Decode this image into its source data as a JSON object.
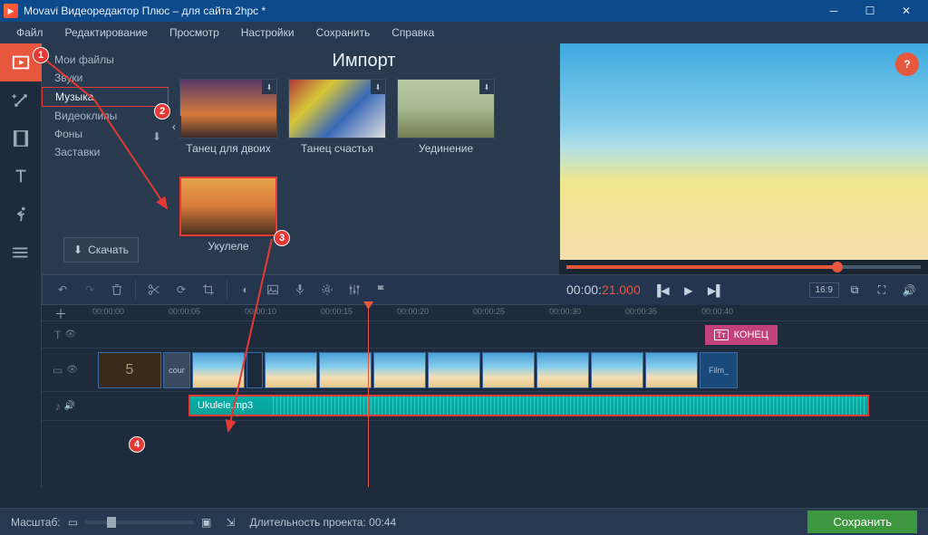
{
  "window": {
    "title": "Movavi Видеоредактор Плюс – для сайта 2hpc *"
  },
  "menu": {
    "file": "Файл",
    "edit": "Редактирование",
    "view": "Просмотр",
    "settings": "Настройки",
    "save": "Сохранить",
    "help": "Справка"
  },
  "import": {
    "title": "Импорт",
    "sidebar": {
      "my_files": "Мои файлы",
      "sounds": "Звуки",
      "music": "Музыка",
      "videoclips": "Видеоклипы",
      "backgrounds": "Фоны",
      "intros": "Заставки"
    },
    "download": "Скачать",
    "clips": {
      "c1": "Танец для двоих",
      "c2": "Танец счастья",
      "c3": "Уединение",
      "c4": "Укулеле"
    }
  },
  "preview": {
    "time_elapsed": "00:00:21.000",
    "time_total": "",
    "aspect": "16:9",
    "help": "?"
  },
  "timeline": {
    "ticks": {
      "t0": "00:00:00",
      "t1": "00:00:05",
      "t2": "00:00:10",
      "t3": "00:00:15",
      "t4": "00:00:20",
      "t5": "00:00:25",
      "t6": "00:00:30",
      "t7": "00:00:35",
      "t8": "00:00:40"
    },
    "intro_badge": "5",
    "intro_label": "cour",
    "end_label": "КОНЕЦ",
    "film_end": "Film_",
    "audio_name": "Ukulele.mp3"
  },
  "footer": {
    "scale_label": "Масштаб:",
    "duration_label": "Длительность проекта:",
    "duration_value": "00:44",
    "save": "Сохранить"
  },
  "markers": {
    "m1": "1",
    "m2": "2",
    "m3": "3",
    "m4": "4"
  }
}
